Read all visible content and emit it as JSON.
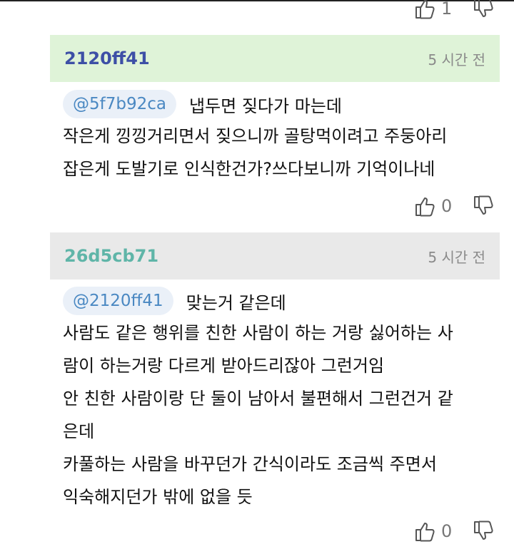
{
  "top_votes": {
    "likes": "1"
  },
  "comments": [
    {
      "author": "2120ff41",
      "time": "5 시간 전",
      "header_bg": "#dff3d8",
      "author_color": "#3d4fa6",
      "mention": "@5f7b92ca",
      "mention_text": "냅두면 짖다가 마는데",
      "lines": [
        "작은게 낑낑거리면서 짖으니까 골탕먹이려고 주둥아리",
        "잡은게 도발기로 인식한건가?쓰다보니까 기억이나네"
      ],
      "likes": "0"
    },
    {
      "author": "26d5cb71",
      "time": "5 시간 전",
      "header_bg": "#e9e9e9",
      "author_color": "#5fb5a8",
      "mention": "@2120ff41",
      "mention_text": "맞는거 같은데",
      "lines": [
        "사람도 같은 행위를 친한 사람이 하는 거랑 싫어하는 사",
        "람이 하는거랑 다르게 받아드리잖아 그런거임",
        "안 친한 사람이랑 단 둘이 남아서 불편해서 그런건거 같",
        "은데",
        "카풀하는 사람을 바꾸던가 간식이라도 조금씩 주면서",
        "익숙해지던가 밖에 없을 듯"
      ],
      "likes": "0"
    }
  ]
}
